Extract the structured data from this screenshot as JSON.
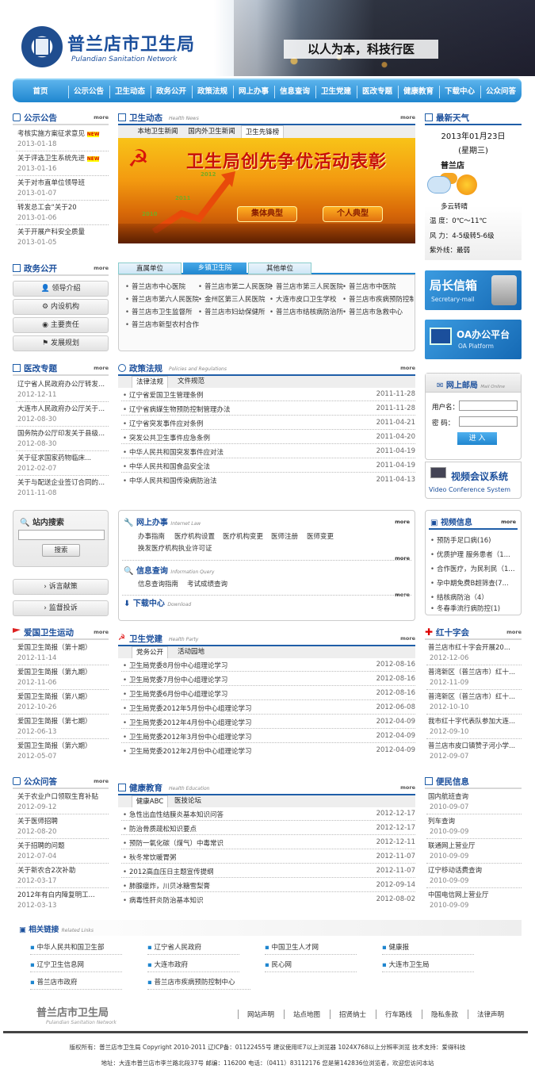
{
  "header": {
    "site_title": "普兰店市卫生局",
    "site_sub": "Pulandian Sanitation Network",
    "slogan": "以人为本，科技行医"
  },
  "nav": [
    "首页",
    "公示公告",
    "卫生动态",
    "政务公开",
    "政策法规",
    "网上办事",
    "信息查询",
    "卫生党建",
    "医改专题",
    "健康教育",
    "下载中心",
    "公众问答"
  ],
  "more": "more",
  "announce": {
    "title": "公示公告",
    "items": [
      {
        "text": "考核实施方案征求意见",
        "new": "NEW",
        "date": "2013-01-18"
      },
      {
        "text": "关于评选卫生系统先进",
        "new": "NEW",
        "date": "2013-01-16"
      },
      {
        "text": "关于对市直单位领导班",
        "date": "2013-01-07"
      },
      {
        "text": "转发总工会“关于20",
        "date": "2013-01-06"
      },
      {
        "text": "关于开展产科安全质量",
        "date": "2013-01-05"
      }
    ]
  },
  "gov": {
    "title": "政务公开",
    "buttons": [
      "领导介绍",
      "内设机构",
      "主要责任",
      "发展规划"
    ]
  },
  "reform": {
    "title": "医改专题",
    "items": [
      {
        "text": "辽宁省人民政府办公厅转发...",
        "date": "2012-12-11"
      },
      {
        "text": "大连市人民政府办公厅关于...",
        "date": "2012-08-30"
      },
      {
        "text": "国务院办公厅印发关于县级...",
        "date": "2012-08-30"
      },
      {
        "text": "关于征求国家药物临床...",
        "date": "2012-02-07"
      },
      {
        "text": "关于与配送企业签订合同的...",
        "date": "2011-11-08"
      }
    ]
  },
  "search": {
    "title": "站内搜索",
    "button": "搜索"
  },
  "side_buttons": [
    "诉言献策",
    "监督投诉"
  ],
  "patriotic": {
    "title": "爱国卫生运动",
    "items": [
      {
        "text": "爱国卫生简报（第十期）",
        "date": "2012-11-14"
      },
      {
        "text": "爱国卫生简报（第九期）",
        "date": "2012-11-06"
      },
      {
        "text": "爱国卫生简报（第八期）",
        "date": "2012-10-26"
      },
      {
        "text": "爱国卫生简报（第七期）",
        "date": "2012-06-13"
      },
      {
        "text": "爱国卫生简报（第六期）",
        "date": "2012-05-07"
      }
    ]
  },
  "qa": {
    "title": "公众问答",
    "items": [
      {
        "text": "关于农业户口领取生育补贴",
        "date": "2012-09-12"
      },
      {
        "text": "关于医师招聘",
        "date": "2012-08-20"
      },
      {
        "text": "关于招聘的问题",
        "date": "2012-07-04"
      },
      {
        "text": "关于新农合2次补助",
        "date": "2012-03-17"
      },
      {
        "text": "2012年有白内障复明工...",
        "date": "2012-03-13"
      }
    ]
  },
  "dynamics": {
    "title": "卫生动态",
    "en": "Health News",
    "tabs": [
      "本地卫生新闻",
      "国内外卫生新闻",
      "卫生先锋榜"
    ],
    "banner_title": "卫生局创先争优活动表彰",
    "banner_btn1": "集体典型",
    "banner_btn2": "个人典型",
    "years": [
      "2010",
      "2011",
      "2012"
    ]
  },
  "units": {
    "tabs": [
      "直属单位",
      "乡镇卫生院",
      "其他单位"
    ],
    "items": [
      [
        "普兰店市中心医院",
        "普兰店市第二人民医院",
        "普兰店市第三人民医院",
        "普兰店市中医院"
      ],
      [
        "普兰店市第六人民医院",
        "金州区第三人民医院",
        "大连市皮口卫生学校",
        "普兰店市疾病预防控制"
      ],
      [
        "普兰店市卫生监督所",
        "普兰店市妇幼保健所",
        "普兰店市结核病防治所",
        "普兰店市急救中心"
      ],
      [
        "普兰店市新型农村合作"
      ]
    ]
  },
  "policy": {
    "title": "政策法规",
    "en": "Policies and Regulations",
    "tabs": [
      "法律法规",
      "文件规范"
    ],
    "items": [
      {
        "text": "辽宁省爱国卫生管理条例",
        "date": "2011-11-28"
      },
      {
        "text": "辽宁省病媒生物预防控制管理办法",
        "date": "2011-11-28"
      },
      {
        "text": "辽宁省突发事件应对条例",
        "date": "2011-04-21"
      },
      {
        "text": "突发公共卫生事件应急条例",
        "date": "2011-04-20"
      },
      {
        "text": "中华人民共和国突发事件应对法",
        "date": "2011-04-19"
      },
      {
        "text": "中华人民共和国食品安全法",
        "date": "2011-04-19"
      },
      {
        "text": "中华人民共和国传染病防治法",
        "date": "2011-04-13"
      }
    ]
  },
  "online": {
    "title": "网上办事",
    "en": "Internet Law",
    "links1": [
      "办事指南",
      "医疗机构设置",
      "医疗机构变更",
      "医师注册",
      "医师变更"
    ],
    "links2": [
      "换发医疗机构执业许可证"
    ],
    "query_title": "信息查询",
    "query_en": "Information Query",
    "query_links": [
      "信息查询指南",
      "考试成绩查询"
    ],
    "download_title": "下载中心",
    "download_en": "Download"
  },
  "party": {
    "title": "卫生党建",
    "en": "Health Party",
    "tabs": [
      "党务公开",
      "活动园地"
    ],
    "items": [
      {
        "text": "卫生局党委8月份中心组理论学习",
        "date": "2012-08-16"
      },
      {
        "text": "卫生局党委7月份中心组理论学习",
        "date": "2012-08-16"
      },
      {
        "text": "卫生局党委6月份中心组理论学习",
        "date": "2012-08-16"
      },
      {
        "text": "卫生局党委2012年5月份中心组理论学习",
        "date": "2012-06-08"
      },
      {
        "text": "卫生局党委2012年4月份中心组理论学习",
        "date": "2012-04-09"
      },
      {
        "text": "卫生局党委2012年3月份中心组理论学习",
        "date": "2012-04-09"
      },
      {
        "text": "卫生局党委2012年2月份中心组理论学习",
        "date": "2012-04-09"
      }
    ]
  },
  "health_edu": {
    "title": "健康教育",
    "en": "Health Education",
    "tabs": [
      "健康ABC",
      "医技论坛"
    ],
    "items": [
      {
        "text": "急性出血性结膜炎基本知识问答",
        "date": "2012-12-17"
      },
      {
        "text": "防治骨质疏松知识要点",
        "date": "2012-12-17"
      },
      {
        "text": "预防一氧化碳（煤气）中毒常识",
        "date": "2012-12-11"
      },
      {
        "text": "秋冬常饮暖胃粥",
        "date": "2012-11-07"
      },
      {
        "text": "2012高血压日主题宣传提纲",
        "date": "2012-11-07"
      },
      {
        "text": "肺腺瘘炸，川贝冰糖雪梨膏",
        "date": "2012-09-14"
      },
      {
        "text": "病毒性肝炎防治基本知识",
        "date": "2012-08-02"
      }
    ]
  },
  "weather": {
    "title": "最新天气",
    "date": "2013年01月23日",
    "weekday": "(星期三)",
    "city": "普兰店",
    "desc": "多云转晴",
    "rows": [
      {
        "k": "温  度：",
        "v": "0℃～11℃"
      },
      {
        "k": "风  力：",
        "v": "4-5级转5-6级"
      },
      {
        "k": "紫外线：",
        "v": "最弱"
      }
    ]
  },
  "mailbox": {
    "title": "局长信箱",
    "en": "Secretary-mail"
  },
  "oa": {
    "title": "OA办公平台",
    "en": "OA Platform"
  },
  "mail": {
    "title": "网上邮局",
    "en": "Mail Online",
    "user": "用户名：",
    "pwd": "密  码：",
    "btn": "进 入"
  },
  "video_conf": {
    "title": "视频会议系统",
    "en": "Video Conference System"
  },
  "video": {
    "title": "视频信息",
    "items": [
      "预防手足口病(16)",
      "优质护理 服务患者（1...",
      "合作医疗，为民利民（1...",
      "孕中期免费B超筛查(7...",
      "结核病防治（4）",
      "冬春季流行病防控(1)"
    ]
  },
  "redcross": {
    "title": "红十字会",
    "items": [
      {
        "text": "普兰店市红十字会开展20...",
        "date": "2012-12-06"
      },
      {
        "text": "普湾新区（普兰店市）红十...",
        "date": "2012-11-09"
      },
      {
        "text": "普湾新区（普兰店市）红十...",
        "date": "2012-10-10"
      },
      {
        "text": "我市红十字代表队参加大连...",
        "date": "2012-09-10"
      },
      {
        "text": "普兰店市皮口镇赞子河小学...",
        "date": "2012-09-07"
      }
    ]
  },
  "service": {
    "title": "便民信息",
    "items": [
      {
        "text": "国内航班查询",
        "date": "2010-09-07"
      },
      {
        "text": "列车查询",
        "date": "2010-09-09"
      },
      {
        "text": "联通网上营业厅",
        "date": "2010-09-09"
      },
      {
        "text": "辽宁移动话费查询",
        "date": "2010-09-09"
      },
      {
        "text": "中国电信网上营业厅",
        "date": "2010-09-09"
      }
    ]
  },
  "links": {
    "title": "相关链接",
    "en": "Related Links",
    "items": [
      "中华人民共和国卫生部",
      "辽宁省人民政府",
      "中国卫生人才网",
      "健康报",
      "辽宁卫生信息网",
      "大连市政府",
      "民心网",
      "大连市卫生局",
      "普兰店市政府",
      "普兰店市疾病预防控制中心"
    ]
  },
  "footer": {
    "title": "普兰店市卫生局",
    "sub": "Pulandian Sanitation Network",
    "links": [
      "网站声明",
      "站点地图",
      "招贤纳士",
      "行车路线",
      "隐私条款",
      "法律声明"
    ],
    "line1": "版权所有：普兰店市卫生局 Copyright 2010-2011  辽ICP备：01122455号 建议使用IE7以上浏览器 1024X768以上分辨率浏览 技术支持：爱得科技",
    "line2": "地址：大连市普兰店市李兰路北段37号  邮编：116200  电话：（0411）83112176  您是第142836位浏览者，欢迎您访问本站"
  }
}
